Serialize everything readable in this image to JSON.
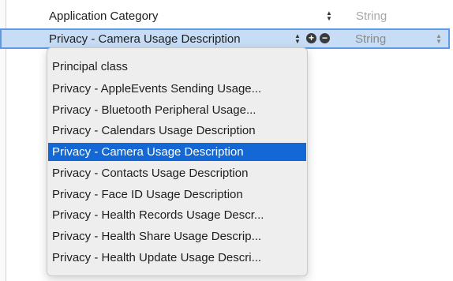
{
  "plist": {
    "rows": [
      {
        "key": "Application Category",
        "type": "String"
      },
      {
        "key": "Privacy - Camera Usage Description",
        "type": "String"
      }
    ]
  },
  "icons": {
    "stepper": "up-down-chevron-icon",
    "add": "plus-circle-icon",
    "remove": "minus-circle-icon"
  },
  "menu": {
    "items": [
      "Principal class",
      "Privacy - AppleEvents Sending Usage...",
      "Privacy - Bluetooth Peripheral Usage...",
      "Privacy - Calendars Usage Description",
      "Privacy - Camera Usage Description",
      "Privacy - Contacts Usage Description",
      "Privacy - Face ID Usage Description",
      "Privacy - Health Records Usage Descr...",
      "Privacy - Health Share Usage Descrip...",
      "Privacy - Health Update Usage Descri..."
    ],
    "selected_index": 4
  },
  "colors": {
    "selection": "#1468d6",
    "row_highlight": "#c7dcf5",
    "row_border": "#5f9ae6"
  }
}
